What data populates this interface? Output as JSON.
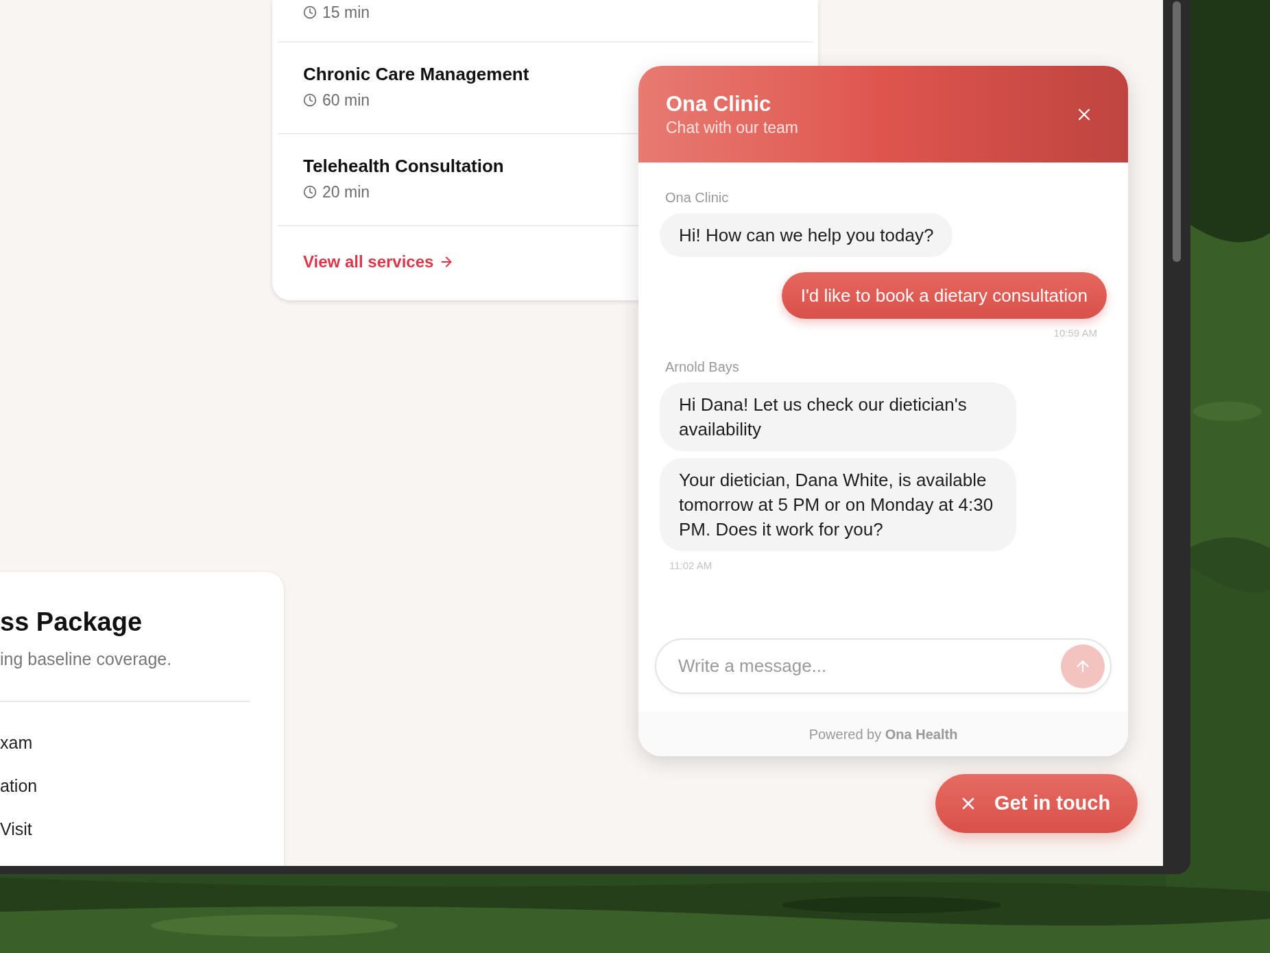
{
  "services": [
    {
      "duration": "15 min"
    },
    {
      "title": "Chronic Care Management",
      "duration": "60 min"
    },
    {
      "title": "Telehealth Consultation",
      "duration": "20 min"
    }
  ],
  "services_link": "View all services",
  "package": {
    "title": "ss Package",
    "description": "ing baseline coverage.",
    "items": [
      "xam",
      "ation",
      "Visit"
    ]
  },
  "chat": {
    "title": "Ona Clinic",
    "subtitle": "Chat with our team",
    "messages": [
      {
        "kind": "incoming",
        "sender": "Ona Clinic",
        "texts": [
          "Hi! How can we help you today?"
        ]
      },
      {
        "kind": "outgoing",
        "texts": [
          "I'd like to book a dietary consultation"
        ],
        "time": "10:59 AM"
      },
      {
        "kind": "incoming",
        "sender": "Arnold Bays",
        "texts": [
          "Hi Dana! Let us check our dietician's availability",
          "Your dietician, Dana White, is available tomorrow at 5 PM or on Monday at 4:30 PM. Does it work for you?"
        ],
        "time": "11:02 AM"
      }
    ],
    "input": {
      "placeholder": "Write a message..."
    },
    "send_button": {
      "disabled": true
    },
    "footer": "Powered by **Ona Health**"
  },
  "launcher": {
    "label": "Get in touch",
    "open": true
  }
}
